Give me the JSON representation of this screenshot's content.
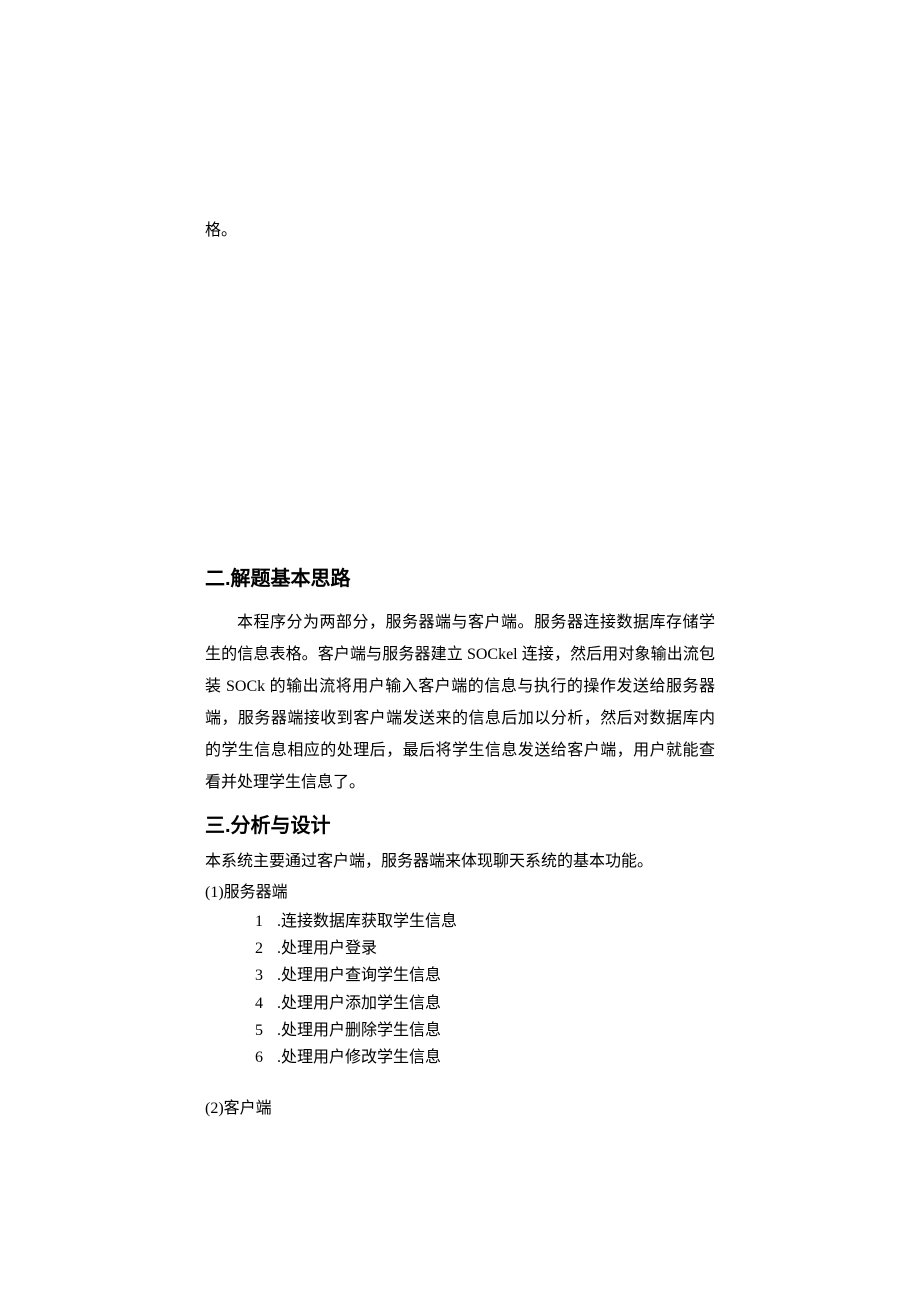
{
  "fragment": "格。",
  "section2": {
    "heading": "二.解题基本思路",
    "body": "本程序分为两部分，服务器端与客户端。服务器连接数据库存储学生的信息表格。客户端与服务器建立 SOCkel 连接，然后用对象输出流包装 SOCk 的输出流将用户输入客户端的信息与执行的操作发送给服务器端，服务器端接收到客户端发送来的信息后加以分析，然后对数据库内的学生信息相应的处理后，最后将学生信息发送给客户端，用户就能查看并处理学生信息了。"
  },
  "section3": {
    "heading": "三.分析与设计",
    "intro": "本系统主要通过客户端，服务器端来体现聊天系统的基本功能。",
    "server": {
      "title": "(1)服务器端",
      "items": [
        ".连接数据库获取学生信息",
        ".处理用户登录",
        ".处理用户查询学生信息",
        ".处理用户添加学生信息",
        ".处理用户删除学生信息",
        ".处理用户修改学生信息"
      ]
    },
    "client": {
      "title": "(2)客户端"
    }
  }
}
